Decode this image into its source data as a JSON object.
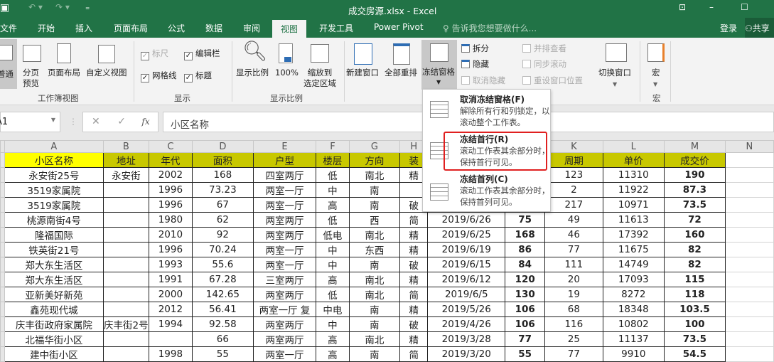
{
  "title": "成交房源.xlsx - Excel",
  "tabs": [
    "文件",
    "开始",
    "插入",
    "页面布局",
    "公式",
    "数据",
    "审阅",
    "视图",
    "开发工具",
    "Power Pivot"
  ],
  "active_tab": "视图",
  "tell_me": "告诉我您想要做什么...",
  "login": "登录",
  "share": "共享",
  "ribbon": {
    "normal": "普通",
    "page_break": "分页\n预览",
    "page_layout": "页面布局",
    "custom_view": "自定义视图",
    "group_workbook": "工作簿视图",
    "ruler": "标尺",
    "formula_bar": "编辑栏",
    "gridlines": "网格线",
    "headings": "标题",
    "group_show": "显示",
    "zoom": "显示比例",
    "zoom100": "100%",
    "zoom_sel": "缩放到\n选定区域",
    "group_zoom": "显示比例",
    "new_window": "新建窗口",
    "arrange_all": "全部重排",
    "freeze": "冻结窗格",
    "split": "拆分",
    "hide": "隐藏",
    "unhide": "取消隐藏",
    "side_by_side": "并排查看",
    "sync_scroll": "同步滚动",
    "reset_pos": "重设窗口位置",
    "switch_window": "切换窗口",
    "macro": "宏",
    "group_macro": "宏"
  },
  "name_box": "A1",
  "formula": "小区名称",
  "menu": [
    {
      "title": "取消冻结窗格(F)",
      "desc": "解除所有行和列锁定，以滚动整个工作表。"
    },
    {
      "title": "冻结首行(R)",
      "desc": "滚动工作表其余部分时，保持首行可见。"
    },
    {
      "title": "冻结首列(C)",
      "desc": "滚动工作表其余部分时，保持首列可见。"
    }
  ],
  "highlight_color": "#e02020",
  "columns": [
    "A",
    "B",
    "C",
    "D",
    "E",
    "F",
    "G",
    "H",
    "I",
    "J",
    "K",
    "L",
    "M",
    "N"
  ],
  "header": [
    "小区名称",
    "地址",
    "年代",
    "面积",
    "户型",
    "楼层",
    "方向",
    "装",
    "",
    "",
    "周期",
    "单价",
    "成交价"
  ],
  "rows": [
    [
      "永安街25号",
      "永安街",
      "2002",
      "168",
      "四室两厅",
      "低",
      "南北",
      "精",
      "",
      "",
      "123",
      "11310",
      "190"
    ],
    [
      "3519家属院",
      "",
      "1996",
      "73.23",
      "两室一厅",
      "中",
      "南",
      "",
      "",
      "",
      "2",
      "11922",
      "87.3"
    ],
    [
      "3519家属院",
      "",
      "1996",
      "67",
      "两室一厅",
      "高",
      "南",
      "破",
      "",
      "",
      "217",
      "10971",
      "73.5"
    ],
    [
      "桃源南街4号",
      "",
      "1980",
      "62",
      "两室两厅",
      "低",
      "西",
      "简",
      "2019/6/26",
      "75",
      "49",
      "11613",
      "72"
    ],
    [
      "隆福国际",
      "",
      "2010",
      "92",
      "两室两厅",
      "低电",
      "南北",
      "精",
      "2019/6/25",
      "168",
      "46",
      "17392",
      "160"
    ],
    [
      "铁英街21号",
      "",
      "1996",
      "70.24",
      "两室一厅",
      "中",
      "东西",
      "精",
      "2019/6/19",
      "86",
      "77",
      "11675",
      "82"
    ],
    [
      "郑大东生活区",
      "",
      "1993",
      "55.6",
      "两室一厅",
      "中",
      "南",
      "破",
      "2019/6/15",
      "84",
      "111",
      "14749",
      "82"
    ],
    [
      "郑大东生活区",
      "",
      "1991",
      "67.28",
      "三室两厅",
      "高",
      "南北",
      "精",
      "2019/6/12",
      "120",
      "20",
      "17093",
      "115"
    ],
    [
      "亚新美好新苑",
      "",
      "2000",
      "142.65",
      "两室两厅",
      "低",
      "南北",
      "简",
      "2019/6/5",
      "130",
      "19",
      "8272",
      "118"
    ],
    [
      "鑫苑现代城",
      "",
      "2012",
      "56.41",
      "两室一厅 复",
      "中电",
      "南",
      "精",
      "2019/5/26",
      "106",
      "68",
      "18348",
      "103.5"
    ],
    [
      "庆丰街政府家属院",
      "庆丰街2号",
      "1994",
      "92.58",
      "两室两厅",
      "中",
      "南",
      "破",
      "2019/4/26",
      "106",
      "116",
      "10802",
      "100"
    ],
    [
      "北福华街小区",
      "",
      "",
      "66",
      "两室两厅",
      "高",
      "南北",
      "精",
      "2019/3/28",
      "77",
      "25",
      "11137",
      "73.5"
    ],
    [
      "建中街小区",
      "",
      "1998",
      "55",
      "两室一厅",
      "高",
      "南",
      "简",
      "2019/3/20",
      "55",
      "77",
      "9910",
      "54.5"
    ]
  ]
}
